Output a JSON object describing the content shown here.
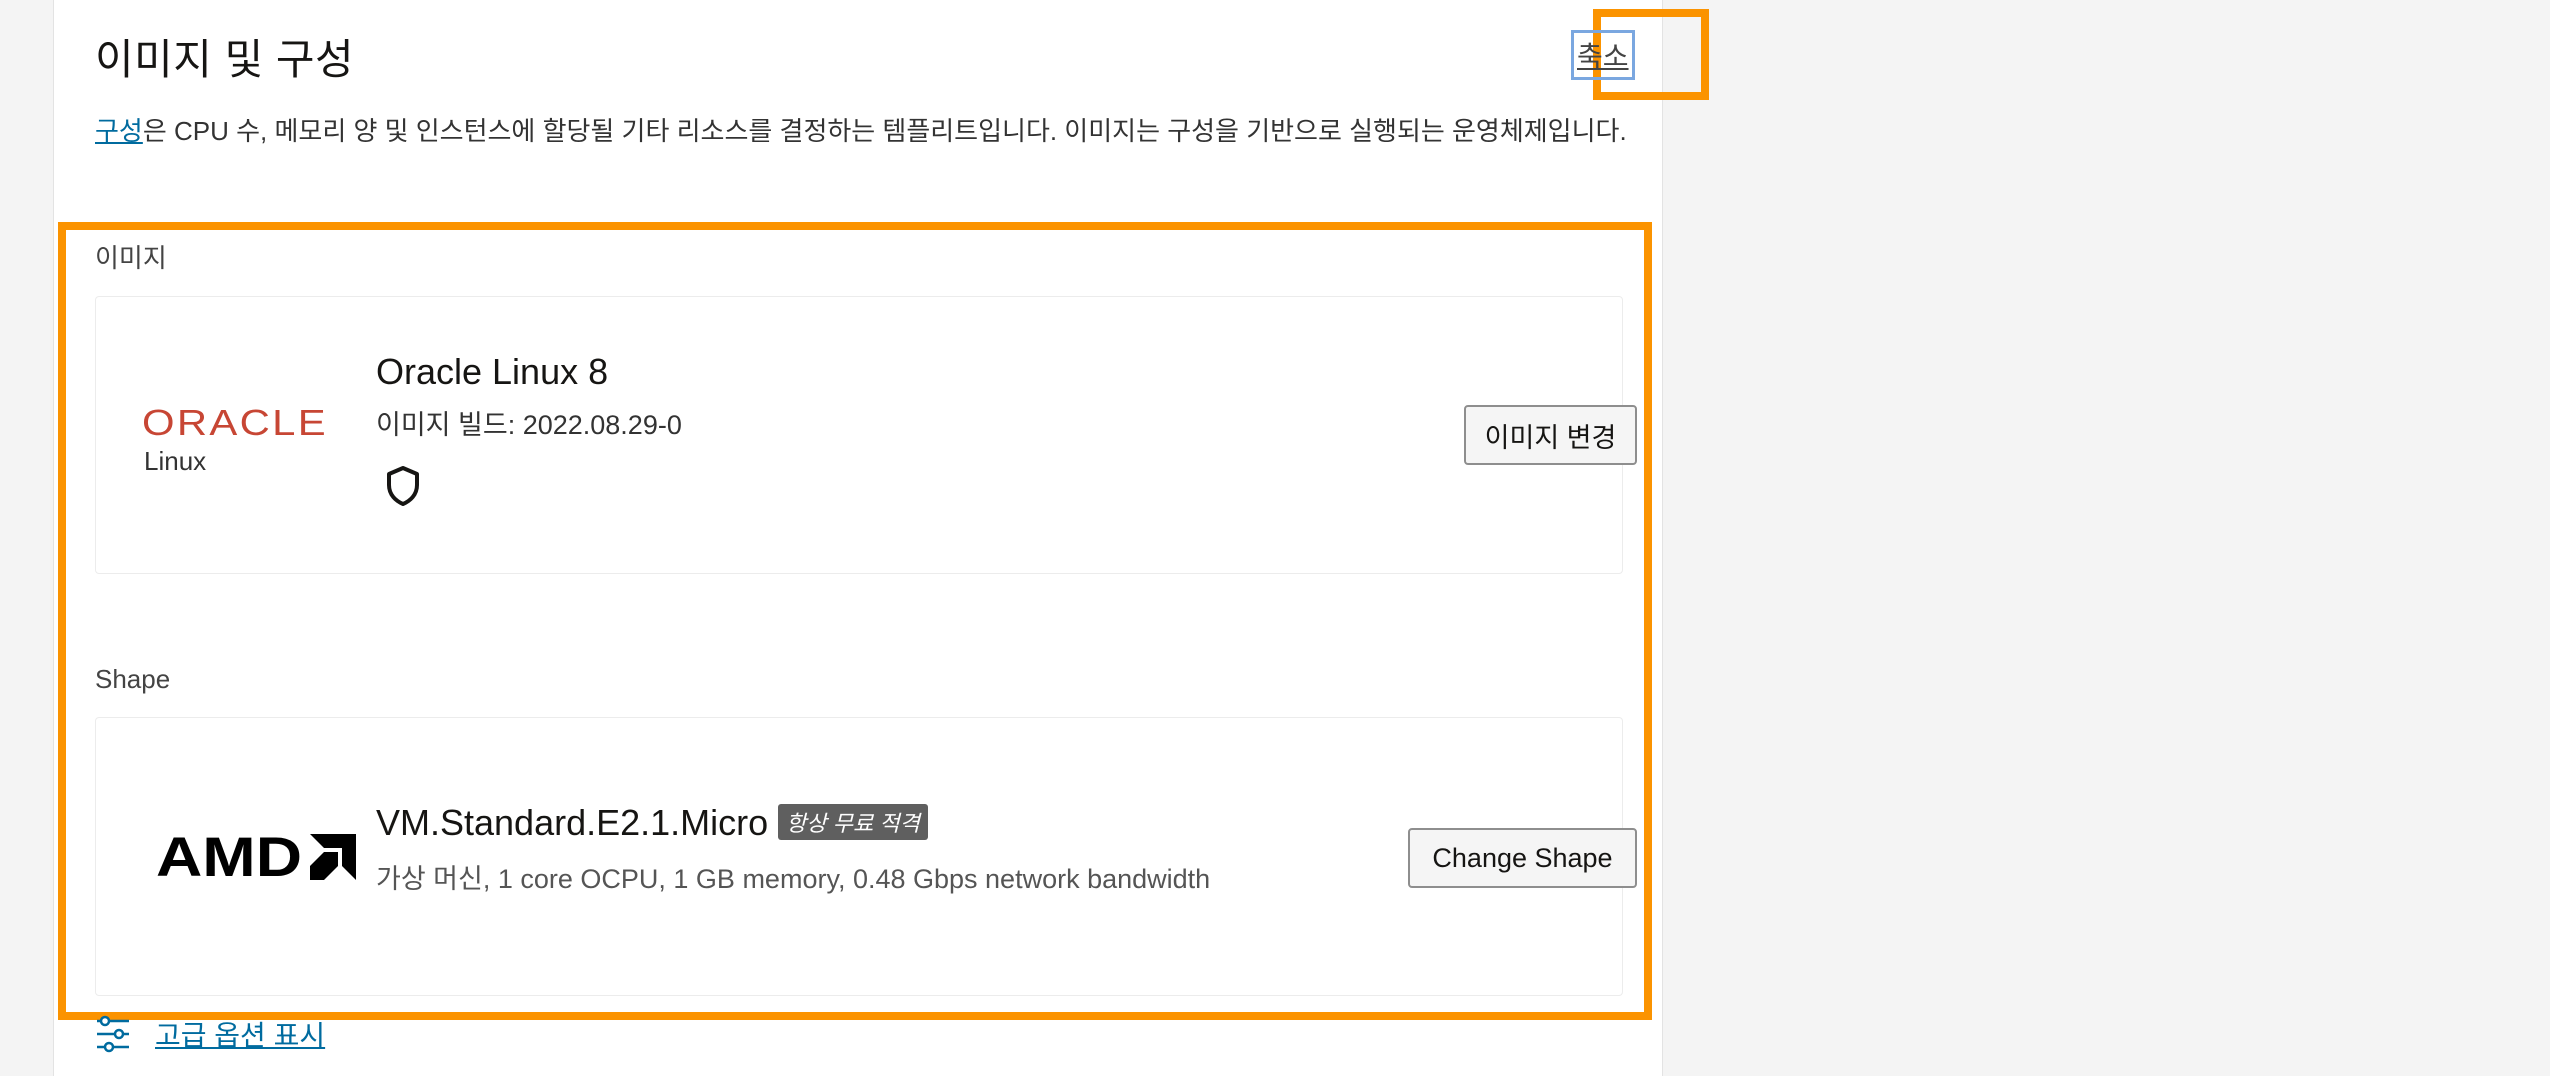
{
  "section": {
    "title": "이미지 및 구성",
    "collapse_label": "축소",
    "description_link": "구성",
    "description_text": "은 CPU 수, 메모리 양 및 인스턴스에 할당될 기타 리소스를 결정하는 템플리트입니다. 이미지는 구성을 기반으로 실행되는 운영체제입니다."
  },
  "image": {
    "label": "이미지",
    "logo_text": "ORACLE",
    "logo_subtext": "Linux",
    "name": "Oracle Linux 8",
    "build": "이미지 빌드: 2022.08.29-0",
    "security_icon": "shield-icon",
    "change_button": "이미지 변경"
  },
  "shape": {
    "label": "Shape",
    "logo_text": "AMD",
    "name": "VM.Standard.E2.1.Micro",
    "badge": "항상 무료 적격",
    "details": "가상 머신, 1 core OCPU, 1 GB memory, 0.48 Gbps network bandwidth",
    "change_button": "Change Shape"
  },
  "advanced": {
    "label": "고급 옵션 표시",
    "icon": "sliders-icon"
  },
  "colors": {
    "highlight": "#fb9300",
    "link": "#006b9f",
    "oracle_red": "#c74634",
    "badge_bg": "#5f5f5f"
  }
}
